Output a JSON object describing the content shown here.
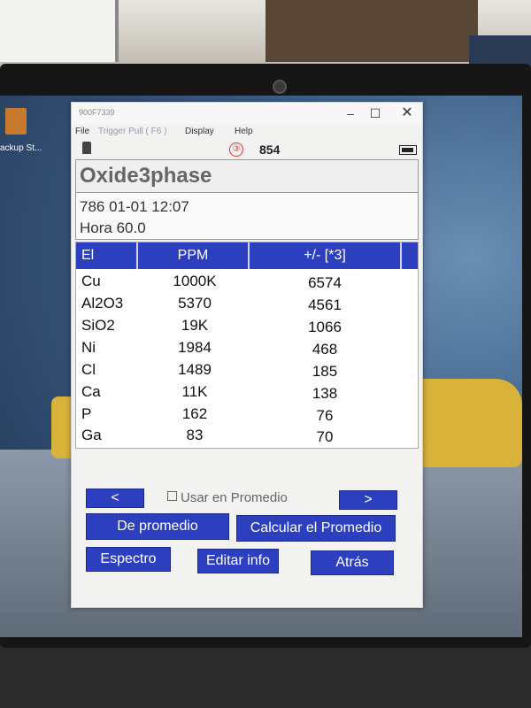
{
  "window": {
    "title": "900F7339",
    "minimize_glyph": "–",
    "maximize_glyph": "☐",
    "close_glyph": "✕"
  },
  "menu": [
    "File",
    "Trigger Pull ( F6 )",
    "Display",
    "Help"
  ],
  "status": {
    "badge": "③",
    "count": "854"
  },
  "desktop": {
    "icon_label": "ackup St..."
  },
  "mode": "Oxide3phase",
  "info": {
    "line1": "786  01-01 12:07",
    "line2": "Hora 60.0"
  },
  "table": {
    "headers": [
      "El",
      "PPM",
      "+/- [*3]"
    ],
    "rows": [
      {
        "el": "Cu",
        "ppm": "1000K",
        "err": "6574"
      },
      {
        "el": "Al2O3",
        "ppm": "5370",
        "err": "4561"
      },
      {
        "el": "SiO2",
        "ppm": "19K",
        "err": "1066"
      },
      {
        "el": "Ni",
        "ppm": "1984",
        "err": "468"
      },
      {
        "el": "Cl",
        "ppm": "1489",
        "err": "185"
      },
      {
        "el": "Ca",
        "ppm": "11K",
        "err": "138"
      },
      {
        "el": "P",
        "ppm": "162",
        "err": "76"
      },
      {
        "el": "Ga",
        "ppm": "83",
        "err": "70"
      }
    ]
  },
  "controls": {
    "prev": "<",
    "next": ">",
    "checkbox_label": "Usar en Promedio",
    "checkbox_checked": false,
    "de_promedio": "De promedio",
    "calcular": "Calcular el Promedio",
    "espectro": "Espectro",
    "editar": "Editar info",
    "atras": "Atrás"
  },
  "colors": {
    "accent_blue": "#2c3fbf",
    "badge_red": "#d33"
  }
}
